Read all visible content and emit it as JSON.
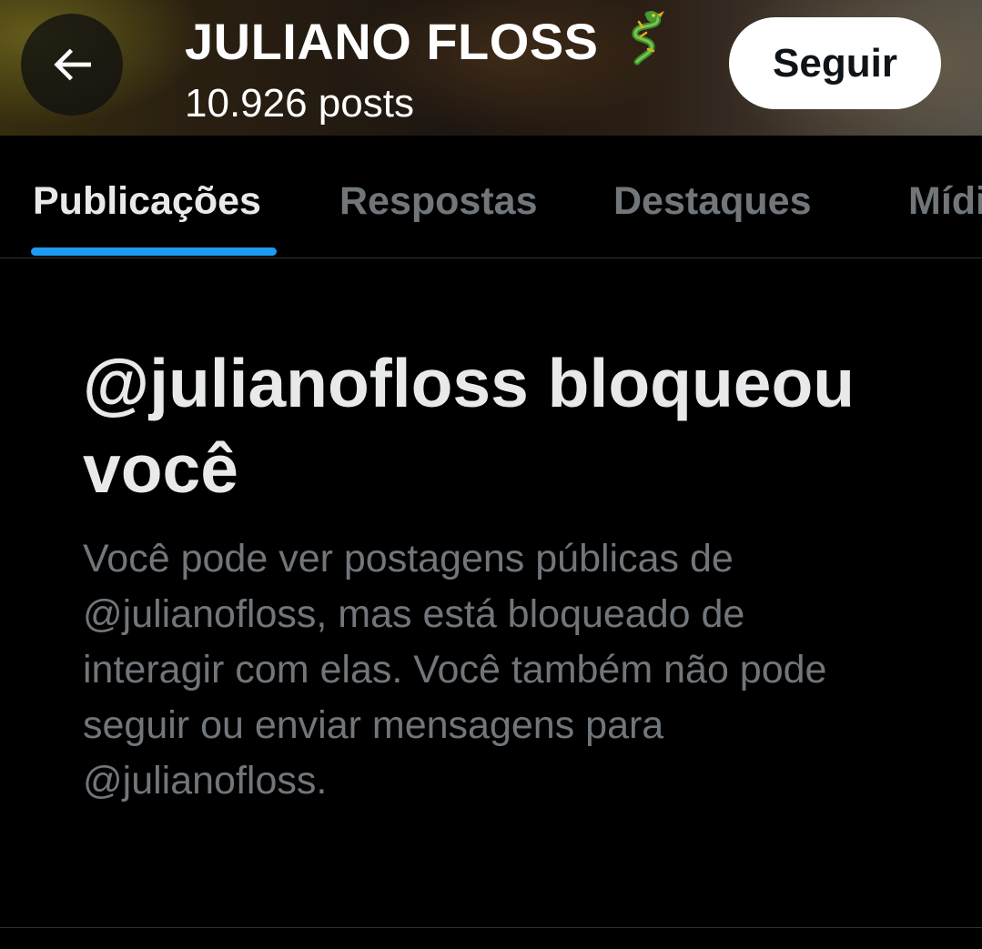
{
  "header": {
    "profile_name": "JULIANO FLOSS",
    "name_emoji_icon": "dragon-icon",
    "post_count": "10.926 posts",
    "back_icon": "arrow-left-icon",
    "follow_label": "Seguir"
  },
  "tabs": [
    {
      "label": "Publicações",
      "active": true
    },
    {
      "label": "Respostas",
      "active": false
    },
    {
      "label": "Destaques",
      "active": false
    },
    {
      "label": "Mídia",
      "active": false
    }
  ],
  "blocked": {
    "title": "@julianofloss bloqueou você",
    "body": "Você pode ver postagens públicas de @julianofloss, mas está bloqueado de interagir com elas. Você também não pode seguir ou enviar mensagens para @julianofloss."
  },
  "colors": {
    "background": "#000000",
    "accent": "#1d9bf0",
    "primary_text": "#e7e9ea",
    "secondary_text": "#71767b",
    "divider": "#2f3336",
    "follow_button_bg": "#ffffff"
  }
}
